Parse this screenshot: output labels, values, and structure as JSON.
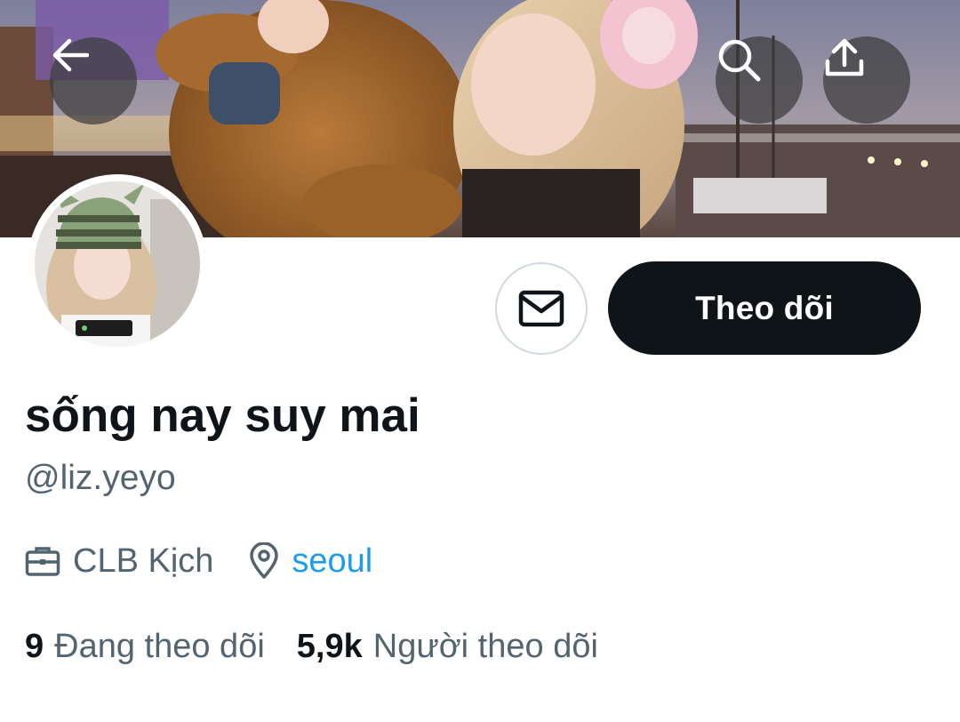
{
  "header": {
    "back_icon": "arrow-left-icon",
    "search_icon": "search-icon",
    "share_icon": "share-upload-icon"
  },
  "profile": {
    "display_name": "sống nay suy mai",
    "handle": "@liz.yeyo",
    "job": "CLB Kịch",
    "location": "seoul",
    "job_icon": "briefcase-icon",
    "location_icon": "location-pin-icon"
  },
  "actions": {
    "message_icon": "envelope-icon",
    "follow_label": "Theo dõi"
  },
  "stats": {
    "following_count": "9",
    "following_label": "Đang theo dõi",
    "followers_count": "5,9k",
    "followers_label": "Người theo dõi"
  },
  "colors": {
    "text_primary": "#0f1419",
    "text_secondary": "#536471",
    "link": "#1d9bf0",
    "button_dark": "#0f1419",
    "border": "#cfd9de"
  }
}
